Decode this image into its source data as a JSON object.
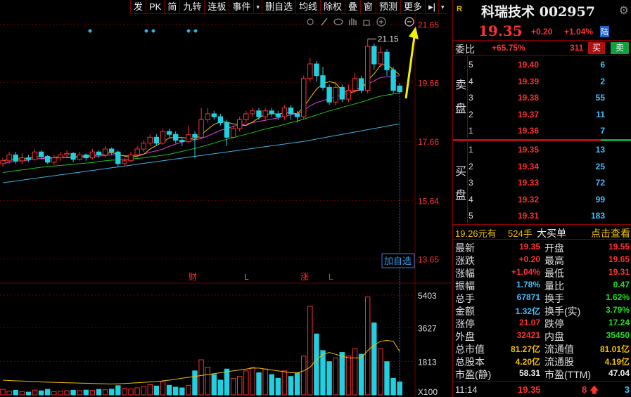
{
  "toolbar": [
    "发",
    "PK",
    "简",
    "九转",
    "连板",
    "事件",
    "▾",
    "删自选",
    "均线",
    "除权",
    "叠",
    "窗",
    "预测",
    "更多",
    "▸|",
    "▾"
  ],
  "chart_icons": [
    "settings-icon",
    "pen-icon",
    "eye-icon",
    "hand-icon",
    "lock-icon",
    "zoom-in-icon",
    "zoom-out-icon"
  ],
  "chart_data": {
    "type": "candlestick",
    "price_axis_ticks": [
      "21.65",
      "19.66",
      "17.66",
      "15.64",
      "13.65"
    ],
    "price_range": [
      12.9,
      22.0
    ],
    "volume_axis_ticks": [
      "5403",
      "3627",
      "1813"
    ],
    "volume_unit": "X100",
    "high_label": "21.15",
    "event_markers": [
      "财",
      "L",
      "涨",
      "L"
    ],
    "add_watch_label": "加自选",
    "colors": {
      "up": "#ff3030",
      "down": "#20d0e0",
      "ma5": "#f0f0f0",
      "ma10": "#f0c000",
      "ma20": "#e040e0",
      "ma30": "#20c020",
      "ma60": "#40b0e0",
      "grid": "#6b0000"
    },
    "candles": [
      [
        16.9,
        17.0,
        16.8,
        17.1
      ],
      [
        17.0,
        17.2,
        16.9,
        17.3
      ],
      [
        17.2,
        17.0,
        16.9,
        17.3
      ],
      [
        17.0,
        17.1,
        16.9,
        17.25
      ],
      [
        17.1,
        17.05,
        16.95,
        17.2
      ],
      [
        17.05,
        17.3,
        17.0,
        17.4
      ],
      [
        17.3,
        17.15,
        17.05,
        17.35
      ],
      [
        17.15,
        16.95,
        16.9,
        17.2
      ],
      [
        16.95,
        17.1,
        16.85,
        17.2
      ],
      [
        17.1,
        17.2,
        17.0,
        17.3
      ],
      [
        17.2,
        17.25,
        17.1,
        17.35
      ],
      [
        17.25,
        17.05,
        16.95,
        17.3
      ],
      [
        17.05,
        17.2,
        17.0,
        17.3
      ],
      [
        17.2,
        17.1,
        17.0,
        17.25
      ],
      [
        17.1,
        17.3,
        17.05,
        17.4
      ],
      [
        17.3,
        17.2,
        17.1,
        17.35
      ],
      [
        17.2,
        17.4,
        17.1,
        17.5
      ],
      [
        17.4,
        17.3,
        17.2,
        17.45
      ],
      [
        17.3,
        16.9,
        16.8,
        17.35
      ],
      [
        16.9,
        17.0,
        16.85,
        17.1
      ],
      [
        17.0,
        17.2,
        16.95,
        17.3
      ],
      [
        17.2,
        17.4,
        17.1,
        17.5
      ],
      [
        17.4,
        17.6,
        17.3,
        17.7
      ],
      [
        17.6,
        17.8,
        17.5,
        17.9
      ],
      [
        17.8,
        17.6,
        17.5,
        17.9
      ],
      [
        17.6,
        18.0,
        17.55,
        18.1
      ],
      [
        18.0,
        17.9,
        17.8,
        18.1
      ],
      [
        17.9,
        17.7,
        17.6,
        18.0
      ],
      [
        17.7,
        17.65,
        17.5,
        17.8
      ],
      [
        17.65,
        17.9,
        17.6,
        18.2
      ],
      [
        17.9,
        17.8,
        17.1,
        18.0
      ],
      [
        17.8,
        18.4,
        17.75,
        18.8
      ],
      [
        18.4,
        18.6,
        18.3,
        18.8
      ],
      [
        18.6,
        18.5,
        18.4,
        18.7
      ],
      [
        18.5,
        18.3,
        18.2,
        18.6
      ],
      [
        18.3,
        17.8,
        17.5,
        18.4
      ],
      [
        17.8,
        18.1,
        17.75,
        18.2
      ],
      [
        18.1,
        18.4,
        18.0,
        18.5
      ],
      [
        18.4,
        18.6,
        18.3,
        18.7
      ],
      [
        18.6,
        18.7,
        18.5,
        18.8
      ],
      [
        18.7,
        18.5,
        18.4,
        18.8
      ],
      [
        18.5,
        18.7,
        18.4,
        18.8
      ],
      [
        18.7,
        18.6,
        18.5,
        18.8
      ],
      [
        18.6,
        18.5,
        18.4,
        18.7
      ],
      [
        18.5,
        18.8,
        18.4,
        18.9
      ],
      [
        18.8,
        18.6,
        18.4,
        18.9
      ],
      [
        18.6,
        18.5,
        18.3,
        18.7
      ],
      [
        18.5,
        19.8,
        18.4,
        19.9
      ],
      [
        19.8,
        20.3,
        19.7,
        20.5
      ],
      [
        20.3,
        19.9,
        19.7,
        20.4
      ],
      [
        19.9,
        19.5,
        19.4,
        20.2
      ],
      [
        19.5,
        19.0,
        18.9,
        19.6
      ],
      [
        19.0,
        19.5,
        18.9,
        19.7
      ],
      [
        19.5,
        19.1,
        19.0,
        19.6
      ],
      [
        19.1,
        19.4,
        19.0,
        19.6
      ],
      [
        19.4,
        19.8,
        19.3,
        20.0
      ],
      [
        19.8,
        19.4,
        19.3,
        19.9
      ],
      [
        19.4,
        20.9,
        19.3,
        21.15
      ],
      [
        20.9,
        20.3,
        20.1,
        21.0
      ],
      [
        20.3,
        20.7,
        20.2,
        20.9
      ],
      [
        20.7,
        20.1,
        19.9,
        20.8
      ],
      [
        20.1,
        19.4,
        19.3,
        20.2
      ],
      [
        19.55,
        19.35,
        19.31,
        19.65
      ]
    ],
    "ma5": [
      17.0,
      17.05,
      17.06,
      17.07,
      17.07,
      17.13,
      17.14,
      17.09,
      17.11,
      17.14,
      17.11,
      17.12,
      17.16,
      17.16,
      17.18,
      17.21,
      17.24,
      17.28,
      17.22,
      17.16,
      17.12,
      17.16,
      17.22,
      17.4,
      17.52,
      17.64,
      17.78,
      17.8,
      17.79,
      17.77,
      17.73,
      17.89,
      18.07,
      18.24,
      18.33,
      18.32,
      18.26,
      18.22,
      18.2,
      18.32,
      18.46,
      18.58,
      18.6,
      18.6,
      18.62,
      18.64,
      18.6,
      18.84,
      19.14,
      19.44,
      19.62,
      19.7,
      19.64,
      19.4,
      19.3,
      19.36,
      19.44,
      19.74,
      19.96,
      20.26,
      20.28,
      20.1,
      19.93
    ],
    "ma10": [
      16.9,
      16.95,
      16.98,
      17.0,
      17.02,
      17.06,
      17.08,
      17.08,
      17.09,
      17.1,
      17.12,
      17.13,
      17.12,
      17.13,
      17.16,
      17.16,
      17.18,
      17.2,
      17.19,
      17.18,
      17.17,
      17.19,
      17.23,
      17.29,
      17.34,
      17.4,
      17.49,
      17.57,
      17.63,
      17.71,
      17.71,
      17.76,
      17.84,
      17.94,
      18.04,
      18.09,
      18.17,
      18.23,
      18.25,
      18.3,
      18.34,
      18.38,
      18.42,
      18.46,
      18.53,
      18.56,
      18.58,
      18.72,
      18.87,
      18.98,
      19.05,
      19.12,
      19.19,
      19.23,
      19.32,
      19.42,
      19.5,
      19.62,
      19.72,
      19.84,
      19.86,
      19.88,
      19.9
    ],
    "ma20": [
      16.6,
      16.63,
      16.66,
      16.69,
      16.72,
      16.75,
      16.78,
      16.8,
      16.82,
      16.84,
      16.86,
      16.88,
      16.9,
      16.92,
      16.94,
      16.97,
      17.0,
      17.02,
      17.03,
      17.04,
      17.06,
      17.08,
      17.1,
      17.13,
      17.16,
      17.19,
      17.22,
      17.27,
      17.32,
      17.37,
      17.42,
      17.48,
      17.54,
      17.6,
      17.67,
      17.73,
      17.79,
      17.85,
      17.9,
      17.96,
      18.02,
      18.08,
      18.13,
      18.18,
      18.24,
      18.3,
      18.35,
      18.42,
      18.49,
      18.56,
      18.63,
      18.7,
      18.76,
      18.82,
      18.88,
      18.94,
      19.0,
      19.07,
      19.14,
      19.2,
      19.24,
      19.28,
      19.3
    ],
    "ma60": [
      16.25,
      16.28,
      16.31,
      16.34,
      16.37,
      16.4,
      16.43,
      16.46,
      16.49,
      16.52,
      16.55,
      16.58,
      16.61,
      16.64,
      16.67,
      16.7,
      16.73,
      16.76,
      16.79,
      16.82,
      16.85,
      16.88,
      16.91,
      16.94,
      16.97,
      17.0,
      17.03,
      17.06,
      17.09,
      17.12,
      17.15,
      17.18,
      17.21,
      17.24,
      17.27,
      17.3,
      17.33,
      17.36,
      17.39,
      17.42,
      17.45,
      17.48,
      17.51,
      17.54,
      17.57,
      17.6,
      17.63,
      17.66,
      17.7,
      17.74,
      17.78,
      17.82,
      17.86,
      17.9,
      17.94,
      17.98,
      18.02,
      18.06,
      18.1,
      18.14,
      18.18,
      18.22,
      18.26
    ],
    "volumes": [
      300,
      200,
      250,
      180,
      150,
      260,
      220,
      300,
      180,
      200,
      220,
      250,
      230,
      260,
      240,
      300,
      280,
      310,
      500,
      350,
      320,
      380,
      460,
      550,
      480,
      700,
      520,
      420,
      380,
      520,
      1300,
      1900,
      1500,
      1100,
      800,
      1400,
      900,
      1000,
      1300,
      1500,
      1200,
      1400,
      1100,
      900,
      1300,
      1000,
      1200,
      2100,
      4800,
      3300,
      2400,
      1800,
      2000,
      2300,
      2100,
      2500,
      2200,
      5300,
      3900,
      2500,
      1800,
      900,
      700
    ],
    "vol_ma": [
      800,
      780,
      760,
      750,
      740,
      720,
      700,
      690,
      680,
      670,
      660,
      650,
      640,
      630,
      620,
      610,
      600,
      590,
      600,
      620,
      640,
      660,
      680,
      700,
      720,
      760,
      800,
      850,
      900,
      950,
      1000,
      1050,
      1100,
      1150,
      1200,
      1250,
      1300,
      1350,
      1400,
      1450,
      1450,
      1400,
      1350,
      1300,
      1250,
      1200,
      1200,
      1300,
      1500,
      1900,
      2200,
      2300,
      2200,
      2100,
      2000,
      2000,
      2000,
      2400,
      2700,
      2900,
      2950,
      2900,
      2350
    ],
    "vol_max": 5403
  },
  "quote": {
    "badge": "R",
    "title": "科瑞技术 002957",
    "price": "19.35",
    "change": "+0.20",
    "change_pct": "+1.04%",
    "market_tag": "陆",
    "weibi_label": "委比",
    "weibi_value": "+65.75%",
    "weicha_value": "311",
    "buy_btn": "买",
    "sell_btn": "卖",
    "ask_side_label": "卖盘",
    "bid_side_label": "买盘",
    "asks": [
      {
        "level": "5",
        "price": "19.40",
        "vol": "6"
      },
      {
        "level": "4",
        "price": "19.39",
        "vol": "2"
      },
      {
        "level": "3",
        "price": "19.38",
        "vol": "55"
      },
      {
        "level": "2",
        "price": "19.37",
        "vol": "11"
      },
      {
        "level": "1",
        "price": "19.36",
        "vol": "7"
      }
    ],
    "bids": [
      {
        "level": "1",
        "price": "19.35",
        "vol": "13"
      },
      {
        "level": "2",
        "price": "19.34",
        "vol": "25"
      },
      {
        "level": "3",
        "price": "19.33",
        "vol": "72"
      },
      {
        "level": "4",
        "price": "19.32",
        "vol": "99"
      },
      {
        "level": "5",
        "price": "19.31",
        "vol": "183"
      }
    ],
    "big_order_price": "19.26元有",
    "big_order_lots": "524手",
    "big_order_tag": "大买单",
    "big_order_link": "点击查看",
    "stats": [
      {
        "l": "最新",
        "lv": "19.35",
        "lc": "c-red",
        "r": "开盘",
        "rv": "19.55",
        "rc": "c-red"
      },
      {
        "l": "涨跌",
        "lv": "+0.20",
        "lc": "c-red",
        "r": "最高",
        "rv": "19.65",
        "rc": "c-red"
      },
      {
        "l": "涨幅",
        "lv": "+1.04%",
        "lc": "c-red",
        "r": "最低",
        "rv": "19.31",
        "rc": "c-red"
      },
      {
        "l": "振幅",
        "lv": "1.78%",
        "lc": "c-cyan",
        "r": "量比",
        "rv": "0.47",
        "rc": "c-green"
      },
      {
        "l": "总手",
        "lv": "67871",
        "lc": "c-cyan",
        "r": "换手",
        "rv": "1.62%",
        "rc": "c-green"
      },
      {
        "l": "金额",
        "lv": "1.32亿",
        "lc": "c-cyan",
        "r": "换手(实)",
        "rv": "3.79%",
        "rc": "c-green"
      },
      {
        "l": "涨停",
        "lv": "21.07",
        "lc": "c-red",
        "r": "跌停",
        "rv": "17.24",
        "rc": "c-green"
      },
      {
        "l": "外盘",
        "lv": "32421",
        "lc": "c-red",
        "r": "内盘",
        "rv": "35450",
        "rc": "c-green"
      },
      {
        "l": "总市值",
        "lv": "81.27亿",
        "lc": "c-yellow",
        "r": "流通值",
        "rv": "81.01亿",
        "rc": "c-yellow"
      },
      {
        "l": "总股本",
        "lv": "4.20亿",
        "lc": "c-yellow",
        "r": "流通股",
        "rv": "4.19亿",
        "rc": "c-yellow"
      },
      {
        "l": "市盈(静)",
        "lv": "58.31",
        "lc": "c-white",
        "r": "市盈(TTM)",
        "rv": "47.04",
        "rc": "c-white"
      }
    ],
    "last_trade": {
      "time": "11:14",
      "price": "19.35",
      "vol": "8",
      "dir": "🡅",
      "n": "3"
    }
  }
}
